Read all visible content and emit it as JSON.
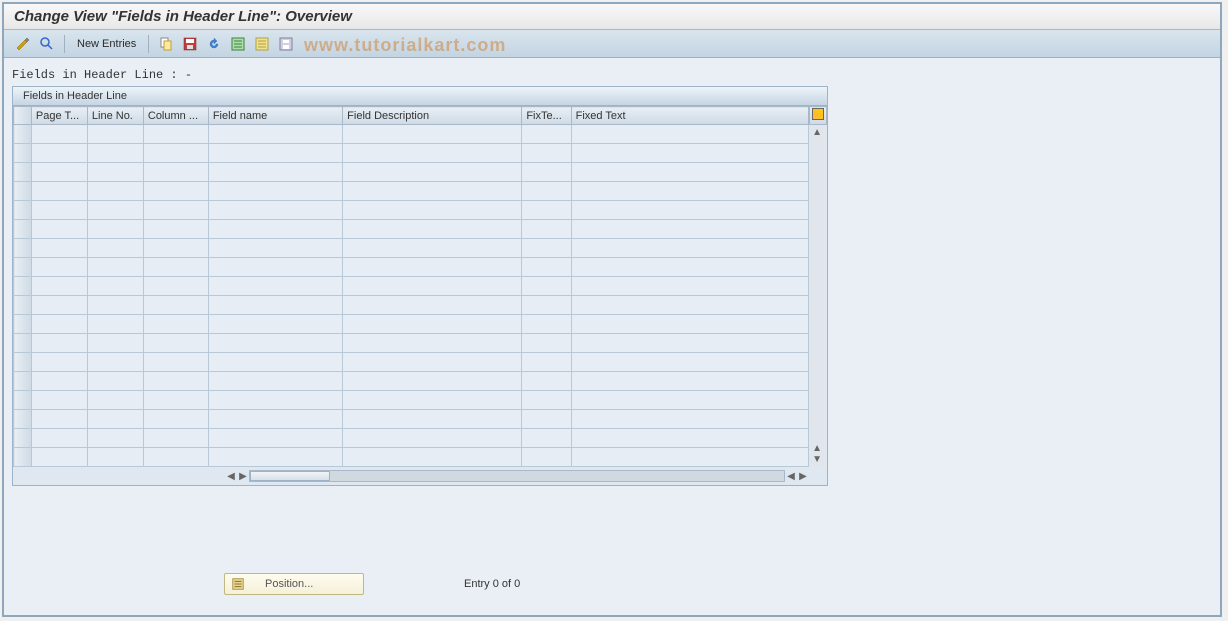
{
  "title": "Change View \"Fields in Header Line\": Overview",
  "toolbar": {
    "new_entries": "New Entries"
  },
  "watermark": "www.tutorialkart.com",
  "subtitle": "Fields in Header Line : -",
  "panel": {
    "header": "Fields in Header Line",
    "columns": {
      "page_t": "Page T...",
      "line_no": "Line No.",
      "column": "Column ...",
      "field_name": "Field name",
      "field_desc": "Field Description",
      "fix_te": "FixTe...",
      "fixed_text": "Fixed Text"
    },
    "row_count": 18
  },
  "footer": {
    "position_btn": "Position...",
    "entry_text": "Entry 0 of 0"
  }
}
